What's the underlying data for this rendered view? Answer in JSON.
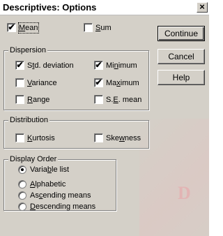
{
  "window": {
    "title": "Descriptives: Options",
    "close_glyph": "×"
  },
  "top_options": {
    "mean": {
      "label_pre": "",
      "label_key": "M",
      "label_post": "ean",
      "checked": true
    },
    "sum": {
      "label_pre": "",
      "label_key": "S",
      "label_post": "um",
      "checked": false
    }
  },
  "dispersion": {
    "title": "Dispersion",
    "std_deviation": {
      "label_pre": "S",
      "label_key": "t",
      "label_post": "d. deviation",
      "checked": true
    },
    "minimum": {
      "label_pre": "Mi",
      "label_key": "n",
      "label_post": "imum",
      "checked": true
    },
    "variance": {
      "label_pre": "",
      "label_key": "V",
      "label_post": "ariance",
      "checked": false
    },
    "maximum": {
      "label_pre": "Ma",
      "label_key": "x",
      "label_post": "imum",
      "checked": true
    },
    "range": {
      "label_pre": "",
      "label_key": "R",
      "label_post": "ange",
      "checked": false
    },
    "se_mean": {
      "label_pre": "S.",
      "label_key": "E",
      "label_post": ". mean",
      "checked": false
    }
  },
  "distribution": {
    "title": "Distribution",
    "kurtosis": {
      "label_pre": "",
      "label_key": "K",
      "label_post": "urtosis",
      "checked": false
    },
    "skewness": {
      "label_pre": "Ske",
      "label_key": "w",
      "label_post": "ness",
      "checked": false
    }
  },
  "display_order": {
    "title": "Display Order",
    "variable_list": {
      "label_pre": "Varia",
      "label_key": "b",
      "label_post": "le list",
      "selected": true
    },
    "alphabetic": {
      "label_pre": "",
      "label_key": "A",
      "label_post": "lphabetic",
      "selected": false
    },
    "ascending": {
      "label_pre": "As",
      "label_key": "c",
      "label_post": "ending means",
      "selected": false
    },
    "descending": {
      "label_pre": "",
      "label_key": "D",
      "label_post": "escending means",
      "selected": false
    }
  },
  "buttons": {
    "continue": "Continue",
    "cancel": "Cancel",
    "help": "Help"
  },
  "check_glyph": "✔",
  "watermark_text": "D"
}
